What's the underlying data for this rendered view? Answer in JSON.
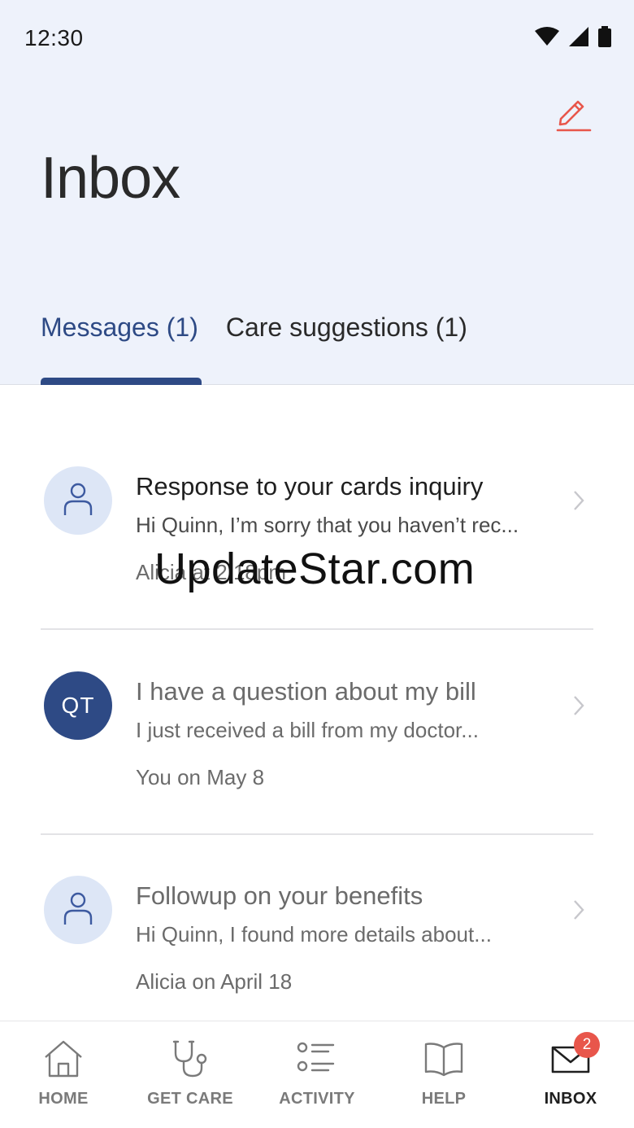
{
  "status_bar": {
    "time": "12:30",
    "icons": [
      "wifi-icon",
      "signal-icon",
      "battery-icon"
    ]
  },
  "header": {
    "title": "Inbox",
    "compose_icon": "pencil-icon"
  },
  "tabs": [
    {
      "label": "Messages (1)",
      "active": true
    },
    {
      "label": "Care suggestions (1)",
      "active": false
    }
  ],
  "messages": [
    {
      "avatar": "person-icon",
      "title": "Response to your cards inquiry",
      "preview": "Hi Quinn, I’m sorry that you haven’t rec...",
      "meta": "Alicia at 2:18pm",
      "unread": true
    },
    {
      "avatar_initials": "QT",
      "title": "I have a question about my bill",
      "preview": "I just received a bill from my doctor...",
      "meta": "You on May 8",
      "unread": false
    },
    {
      "avatar": "person-icon",
      "title": "Followup on your benefits",
      "preview": "Hi Quinn, I found more details about...",
      "meta": "Alicia on April 18",
      "unread": false
    }
  ],
  "watermark": "UpdateStar.com",
  "nav": [
    {
      "label": "HOME",
      "icon": "home-icon"
    },
    {
      "label": "GET CARE",
      "icon": "stethoscope-icon"
    },
    {
      "label": "ACTIVITY",
      "icon": "activity-list-icon"
    },
    {
      "label": "HELP",
      "icon": "book-icon"
    },
    {
      "label": "INBOX",
      "icon": "envelope-icon",
      "active": true,
      "badge": "2"
    }
  ],
  "colors": {
    "accent": "#2e4a85",
    "header_bg": "#eef2fb",
    "compose": "#e8564b",
    "badge": "#e8564b"
  }
}
